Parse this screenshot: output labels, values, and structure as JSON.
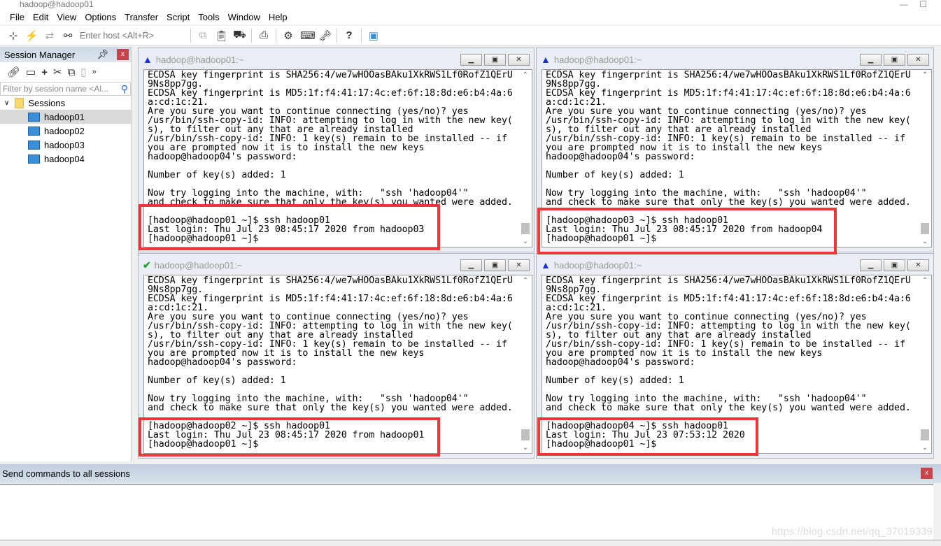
{
  "window": {
    "title": "hadoop@hadoop01"
  },
  "menu": [
    "File",
    "Edit",
    "View",
    "Options",
    "Transfer",
    "Script",
    "Tools",
    "Window",
    "Help"
  ],
  "toolbar": {
    "host_placeholder": "Enter host <Alt+R>"
  },
  "session_manager": {
    "title": "Session Manager",
    "close": "x",
    "filter_placeholder": "Filter by session name <Al...",
    "root": "Sessions",
    "items": [
      {
        "label": "hadoop01",
        "selected": true
      },
      {
        "label": "hadoop02"
      },
      {
        "label": "hadoop03"
      },
      {
        "label": "hadoop04"
      }
    ]
  },
  "panes": [
    {
      "title": "hadoop@hadoop01:~",
      "status_icon": "warning-icon",
      "lines": [
        "ECDSA key fingerprint is SHA256:4/we7wHOOasBAku1XkRWS1Lf0RofZ1QErU",
        "9Ns8pp7gg.",
        "ECDSA key fingerprint is MD5:1f:f4:41:17:4c:ef:6f:18:8d:e6:b4:4a:6",
        "a:cd:1c:21.",
        "Are you sure you want to continue connecting (yes/no)? yes",
        "/usr/bin/ssh-copy-id: INFO: attempting to log in with the new key(",
        "s), to filter out any that are already installed",
        "/usr/bin/ssh-copy-id: INFO: 1 key(s) remain to be installed -- if",
        "you are prompted now it is to install the new keys",
        "hadoop@hadoop04's password:",
        "",
        "Number of key(s) added: 1",
        "",
        "Now try logging into the machine, with:   \"ssh 'hadoop04'\"",
        "and check to make sure that only the key(s) you wanted were added.",
        "",
        "[hadoop@hadoop01 ~]$ ssh hadoop01",
        "Last login: Thu Jul 23 08:45:17 2020 from hadoop03",
        "[hadoop@hadoop01 ~]$"
      ]
    },
    {
      "title": "hadoop@hadoop01:~",
      "status_icon": "warning-icon",
      "lines": [
        "ECDSA key fingerprint is SHA256:4/we7wHOOasBAku1XkRWS1Lf0RofZ1QErU",
        "9Ns8pp7gg.",
        "ECDSA key fingerprint is MD5:1f:f4:41:17:4c:ef:6f:18:8d:e6:b4:4a:6",
        "a:cd:1c:21.",
        "Are you sure you want to continue connecting (yes/no)? yes",
        "/usr/bin/ssh-copy-id: INFO: attempting to log in with the new key(",
        "s), to filter out any that are already installed",
        "/usr/bin/ssh-copy-id: INFO: 1 key(s) remain to be installed -- if",
        "you are prompted now it is to install the new keys",
        "hadoop@hadoop04's password:",
        "",
        "Number of key(s) added: 1",
        "",
        "Now try logging into the machine, with:   \"ssh 'hadoop04'\"",
        "and check to make sure that only the key(s) you wanted were added.",
        "",
        "[hadoop@hadoop03 ~]$ ssh hadoop01",
        "Last login: Thu Jul 23 08:45:17 2020 from hadoop04",
        "[hadoop@hadoop01 ~]$"
      ]
    },
    {
      "title": "hadoop@hadoop01:~",
      "status_icon": "check-icon",
      "lines": [
        "ECDSA key fingerprint is SHA256:4/we7wHOOasBAku1XkRWS1Lf0RofZ1QErU",
        "9Ns8pp7gg.",
        "ECDSA key fingerprint is MD5:1f:f4:41:17:4c:ef:6f:18:8d:e6:b4:4a:6",
        "a:cd:1c:21.",
        "Are you sure you want to continue connecting (yes/no)? yes",
        "/usr/bin/ssh-copy-id: INFO: attempting to log in with the new key(",
        "s), to filter out any that are already installed",
        "/usr/bin/ssh-copy-id: INFO: 1 key(s) remain to be installed -- if",
        "you are prompted now it is to install the new keys",
        "hadoop@hadoop04's password:",
        "",
        "Number of key(s) added: 1",
        "",
        "Now try logging into the machine, with:   \"ssh 'hadoop04'\"",
        "and check to make sure that only the key(s) you wanted were added.",
        "",
        "[hadoop@hadoop02 ~]$ ssh hadoop01",
        "Last login: Thu Jul 23 08:45:17 2020 from hadoop01",
        "[hadoop@hadoop01 ~]$"
      ]
    },
    {
      "title": "hadoop@hadoop01:~",
      "status_icon": "warning-icon",
      "lines": [
        "ECDSA key fingerprint is SHA256:4/we7wHOOasBAku1XkRWS1Lf0RofZ1QErU",
        "9Ns8pp7gg.",
        "ECDSA key fingerprint is MD5:1f:f4:41:17:4c:ef:6f:18:8d:e6:b4:4a:6",
        "a:cd:1c:21.",
        "Are you sure you want to continue connecting (yes/no)? yes",
        "/usr/bin/ssh-copy-id: INFO: attempting to log in with the new key(",
        "s), to filter out any that are already installed",
        "/usr/bin/ssh-copy-id: INFO: 1 key(s) remain to be installed -- if",
        "you are prompted now it is to install the new keys",
        "hadoop@hadoop04's password:",
        "",
        "Number of key(s) added: 1",
        "",
        "Now try logging into the machine, with:   \"ssh 'hadoop04'\"",
        "and check to make sure that only the key(s) you wanted were added.",
        "",
        "[hadoop@hadoop04 ~]$ ssh hadoop01",
        "Last login: Thu Jul 23 07:53:12 2020",
        "[hadoop@hadoop01 ~]$"
      ]
    }
  ],
  "send_commands": {
    "title": "Send commands to all sessions",
    "close": "x"
  },
  "watermark": "https://blog.csdn.net/qq_37019339",
  "colors": {
    "highlight": "#f0363a",
    "close": "#c9434a",
    "panel_header": "#cbd7e4"
  }
}
